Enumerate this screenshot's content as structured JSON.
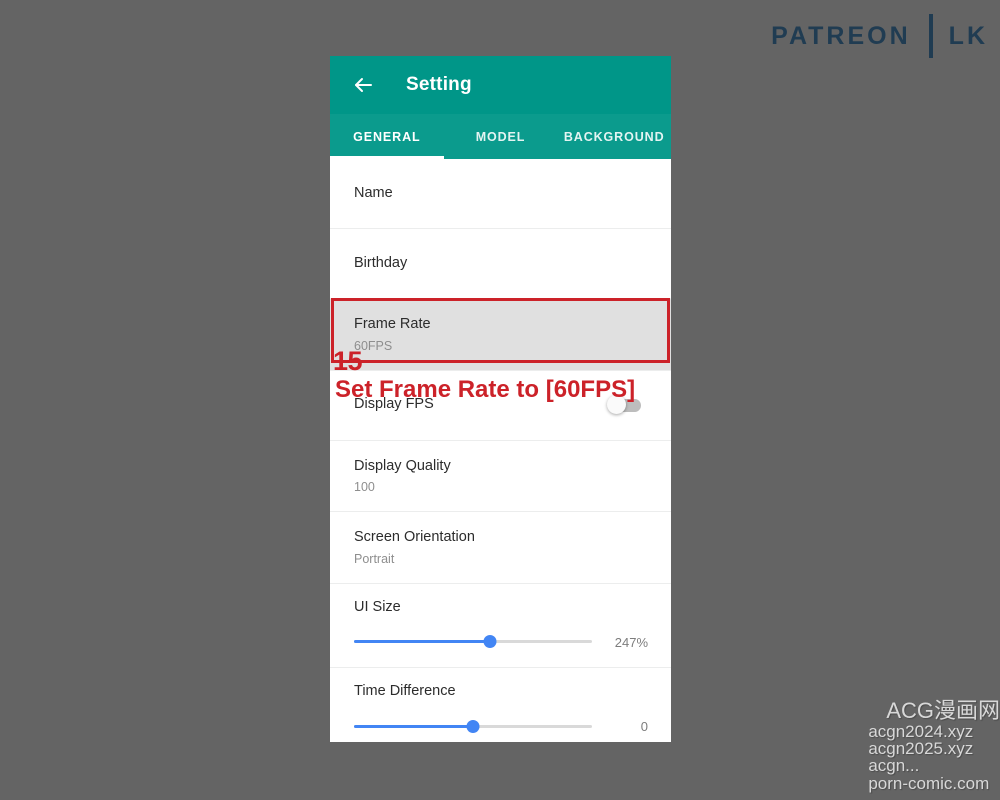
{
  "watermarks": {
    "patreon_word": "PATREON",
    "patreon_lk": "LK",
    "acg_title": "ACG漫画网",
    "acg_lines": [
      "acgn2024.xyz",
      "acgn2025.xyz",
      "acgn...",
      "porn-comic.com"
    ]
  },
  "appbar": {
    "back_icon": "arrow-left-icon",
    "title": "Setting"
  },
  "tabs": [
    {
      "label": "GENERAL",
      "active": true
    },
    {
      "label": "MODEL",
      "active": false
    },
    {
      "label": "BACKGROUND",
      "active": false
    }
  ],
  "rows": [
    {
      "title": "Name",
      "sub": ""
    },
    {
      "title": "Birthday",
      "sub": ""
    },
    {
      "title": "Frame Rate",
      "sub": "60FPS"
    },
    {
      "title": "Display FPS",
      "sub": ""
    },
    {
      "title": "Display Quality",
      "sub": "100"
    },
    {
      "title": "Screen Orientation",
      "sub": "Portrait"
    }
  ],
  "sliders": [
    {
      "title": "UI Size",
      "value": "247%",
      "percent": 57
    },
    {
      "title": "Time Difference",
      "value": "0",
      "percent": 50
    }
  ],
  "annotation": {
    "step": "15",
    "text": "Set Frame Rate to [60FPS]",
    "color": "#cc2229"
  },
  "colors": {
    "accent_teal": "#009688",
    "tabbar_teal": "#0b9b8d",
    "slider_blue": "#4285f4",
    "highlight_row": "#e0e0e0",
    "page_background": "#646464",
    "patreon_navy": "#1d3a52"
  }
}
